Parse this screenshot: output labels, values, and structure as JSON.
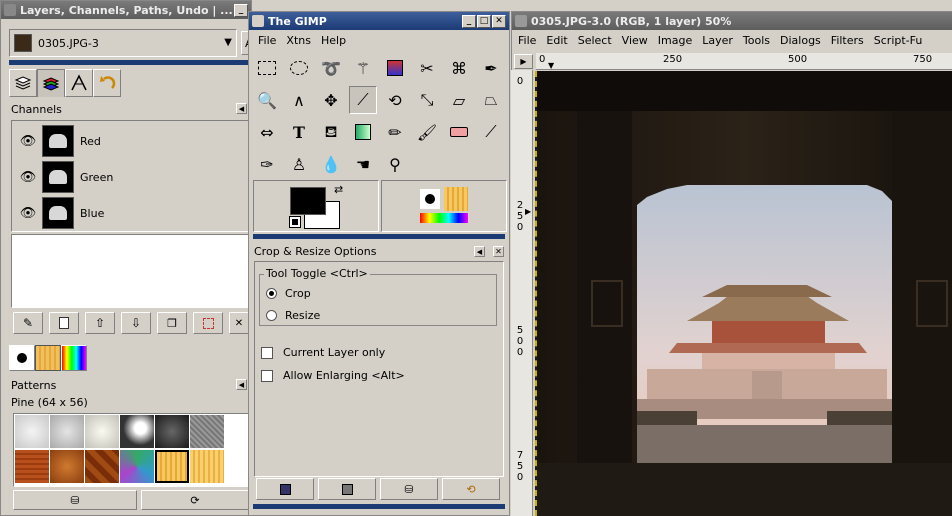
{
  "layers_dialog": {
    "title": "Layers, Channels, Paths, Undo | ...",
    "image_select": "0305.JPG-3",
    "auto_button": "A",
    "channels_label": "Channels",
    "channels": [
      "Red",
      "Green",
      "Blue"
    ],
    "patterns_label": "Patterns",
    "pattern_name": "Pine (64 x 56)"
  },
  "toolbox": {
    "title": "The GIMP",
    "menu": [
      "File",
      "Xtns",
      "Help"
    ],
    "options_title": "Crop & Resize Options",
    "tool_toggle_label": "Tool Toggle  <Ctrl>",
    "radio_crop": "Crop",
    "radio_resize": "Resize",
    "check_current_layer": "Current Layer only",
    "check_allow_enlarging": "Allow Enlarging  <Alt>"
  },
  "image_window": {
    "title": "0305.JPG-3.0 (RGB, 1 layer) 50%",
    "menu": [
      "File",
      "Edit",
      "Select",
      "View",
      "Image",
      "Layer",
      "Tools",
      "Dialogs",
      "Filters",
      "Script-Fu"
    ],
    "ruler_h": [
      "0",
      "250",
      "500",
      "750"
    ],
    "ruler_v": [
      "0",
      "250",
      "500",
      "750"
    ]
  },
  "colors": {
    "title_active": "#1c3a74",
    "title_inactive": "#5d5d5d",
    "panel_bg": "#d4d0c8",
    "foreground": "#000000",
    "background": "#ffffff"
  }
}
